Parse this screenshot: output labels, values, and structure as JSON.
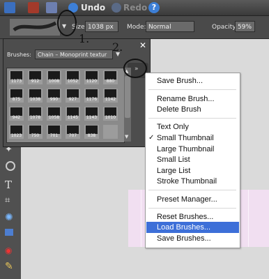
{
  "toolbar": {
    "undo_label": "Undo",
    "redo_label": "Redo"
  },
  "options_bar": {
    "size_label": "Size:",
    "size_value": "1038 px",
    "mode_label": "Mode:",
    "mode_value": "Normal",
    "opacity_label": "Opacity:",
    "opacity_value": "59%"
  },
  "brushes_panel": {
    "brushes_label": "Brushes:",
    "brush_set": "Chain – Monoprint textur",
    "brush_sizes": [
      [
        "1173",
        "912",
        "1008",
        "1052",
        "1120",
        "880"
      ],
      [
        "875",
        "1038",
        "990",
        "927",
        "1176",
        "1142"
      ],
      [
        "942",
        "1078",
        "1058",
        "1145",
        "1143",
        "1010"
      ],
      [
        "1023",
        "750",
        "701",
        "707",
        "838",
        ""
      ]
    ]
  },
  "menu": {
    "items": [
      {
        "label": "Save Brush..."
      },
      {
        "label": "Rename Brush..."
      },
      {
        "label": "Delete Brush"
      },
      {
        "label": "Text Only"
      },
      {
        "label": "Small Thumbnail",
        "checked": true
      },
      {
        "label": "Large Thumbnail"
      },
      {
        "label": "Small List"
      },
      {
        "label": "Large List"
      },
      {
        "label": "Stroke Thumbnail"
      },
      {
        "label": "Preset Manager..."
      },
      {
        "label": "Reset Brushes..."
      },
      {
        "label": "Load Brushes...",
        "highlighted": true
      },
      {
        "label": "Save Brushes..."
      }
    ]
  },
  "annotations": {
    "step1": "1.",
    "step2": "2."
  },
  "colors": {
    "menu_highlight": "#3d6fd8",
    "canvas_pink": "#f1dff1"
  }
}
